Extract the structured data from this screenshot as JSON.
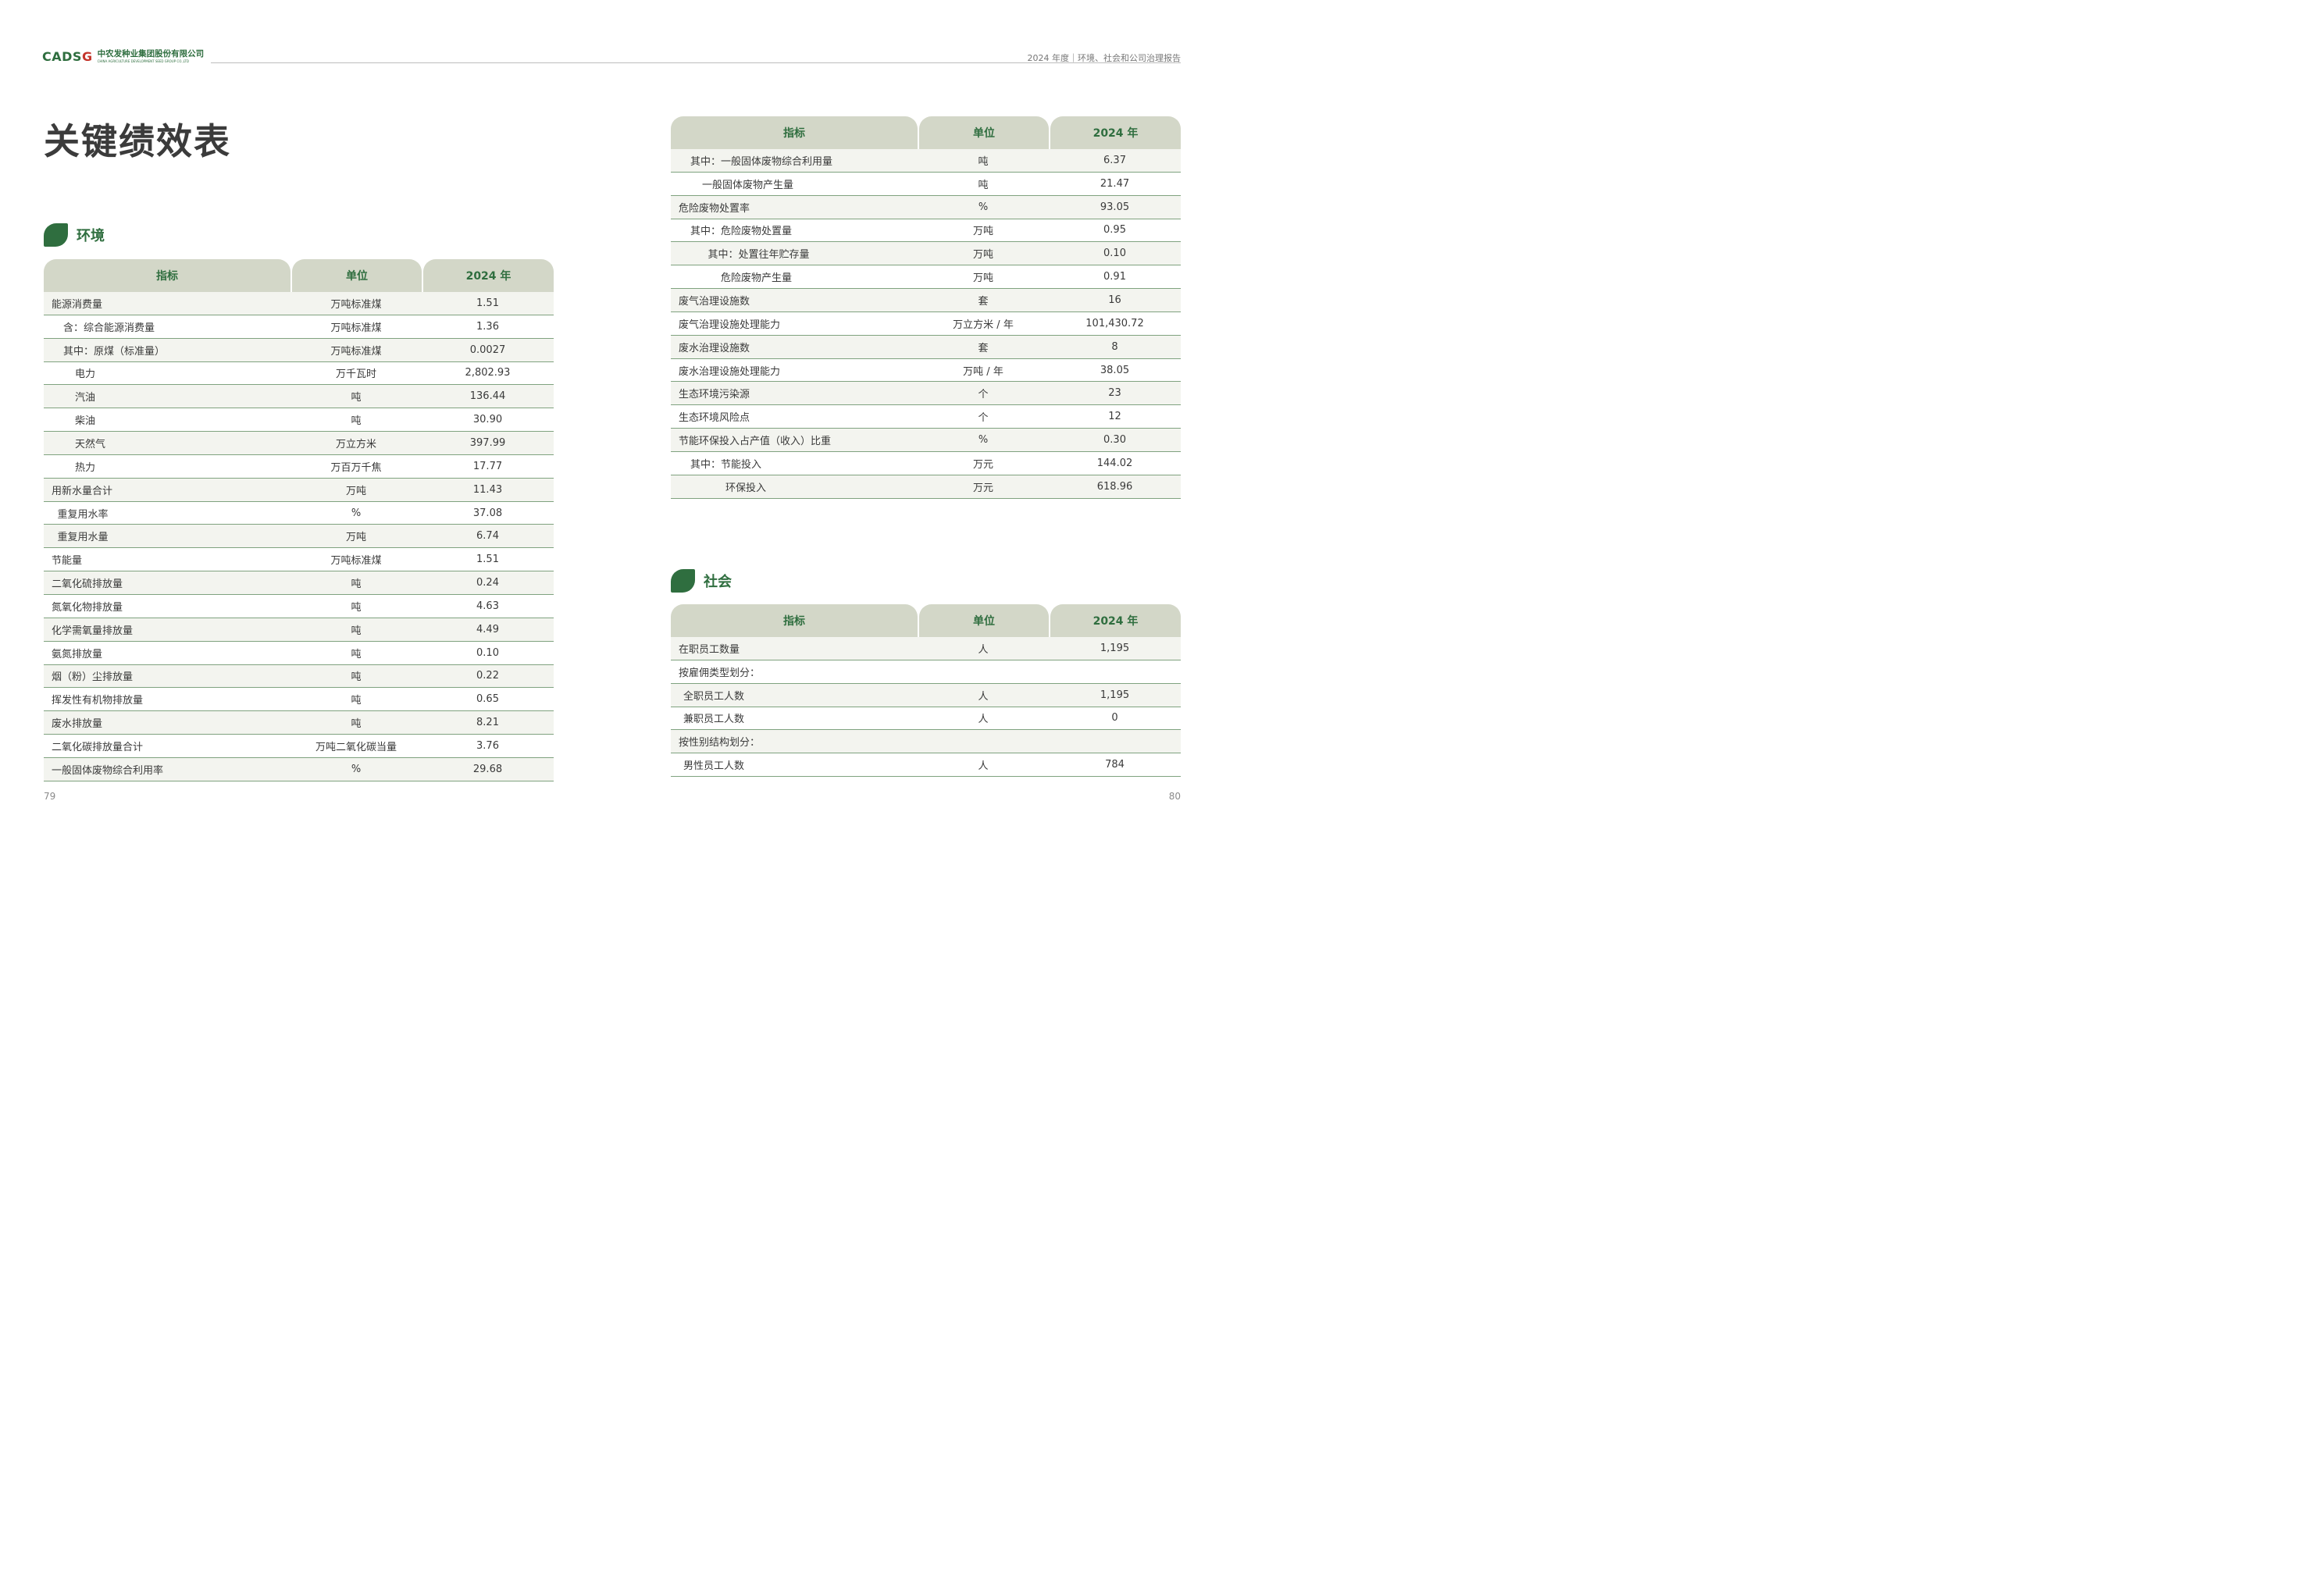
{
  "header": {
    "logo_mark_a": "CADS",
    "logo_mark_b": "G",
    "company_cn": "中农发种业集团股份有限公司",
    "company_en": "CHINA AGRICULTURE DEVELOPMENT SEED GROUP CO.,LTD",
    "report_title": "2024 年度｜环境、社会和公司治理报告"
  },
  "page_title": "关键绩效表",
  "colors": {
    "brand_green": "#2f6e3f",
    "header_fill": "#d3d7c8",
    "row_alt": "#f3f4ef"
  },
  "table_headers": {
    "indicator": "指标",
    "unit": "单位",
    "year": "2024 年"
  },
  "environment": {
    "title": "环境",
    "rows": [
      {
        "name": "能源消费量",
        "indent": 0,
        "unit": "万吨标准煤",
        "value": "1.51"
      },
      {
        "name": "含：综合能源消费量",
        "indent": 1,
        "unit": "万吨标准煤",
        "value": "1.36"
      },
      {
        "name": "其中：原煤（标准量）",
        "indent": 1,
        "unit": "万吨标准煤",
        "value": "0.0027"
      },
      {
        "name": "电力",
        "indent": 2,
        "unit": "万千瓦时",
        "value": "2,802.93"
      },
      {
        "name": "汽油",
        "indent": 2,
        "unit": "吨",
        "value": "136.44"
      },
      {
        "name": "柴油",
        "indent": 2,
        "unit": "吨",
        "value": "30.90"
      },
      {
        "name": "天然气",
        "indent": 2,
        "unit": "万立方米",
        "value": "397.99"
      },
      {
        "name": "热力",
        "indent": 2,
        "unit": "万百万千焦",
        "value": "17.77"
      },
      {
        "name": "用新水量合计",
        "indent": 0,
        "unit": "万吨",
        "value": "11.43"
      },
      {
        "name": "重复用水率",
        "indent": 0.5,
        "unit": "%",
        "value": "37.08"
      },
      {
        "name": "重复用水量",
        "indent": 0.5,
        "unit": "万吨",
        "value": "6.74"
      },
      {
        "name": "节能量",
        "indent": 0,
        "unit": "万吨标准煤",
        "value": "1.51"
      },
      {
        "name": "二氧化硫排放量",
        "indent": 0,
        "unit": "吨",
        "value": "0.24"
      },
      {
        "name": "氮氧化物排放量",
        "indent": 0,
        "unit": "吨",
        "value": "4.63"
      },
      {
        "name": "化学需氧量排放量",
        "indent": 0,
        "unit": "吨",
        "value": "4.49"
      },
      {
        "name": "氨氮排放量",
        "indent": 0,
        "unit": "吨",
        "value": "0.10"
      },
      {
        "name": "烟（粉）尘排放量",
        "indent": 0,
        "unit": "吨",
        "value": "0.22"
      },
      {
        "name": "挥发性有机物排放量",
        "indent": 0,
        "unit": "吨",
        "value": "0.65"
      },
      {
        "name": "废水排放量",
        "indent": 0,
        "unit": "吨",
        "value": "8.21"
      },
      {
        "name": "二氧化碳排放量合计",
        "indent": 0,
        "unit": "万吨二氧化碳当量",
        "value": "3.76"
      },
      {
        "name": "一般固体废物综合利用率",
        "indent": 0,
        "unit": "%",
        "value": "29.68"
      }
    ]
  },
  "environment_cont": {
    "rows": [
      {
        "name": "其中：一般固体废物综合利用量",
        "indent": 1,
        "unit": "吨",
        "value": "6.37"
      },
      {
        "name": "一般固体废物产生量",
        "indent": 2,
        "unit": "吨",
        "value": "21.47"
      },
      {
        "name": "危险废物处置率",
        "indent": 0,
        "unit": "%",
        "value": "93.05"
      },
      {
        "name": "其中：危险废物处置量",
        "indent": 1,
        "unit": "万吨",
        "value": "0.95"
      },
      {
        "name": "其中：处置往年贮存量",
        "indent": 2.5,
        "unit": "万吨",
        "value": "0.10"
      },
      {
        "name": "危险废物产生量",
        "indent": 3.6,
        "unit": "万吨",
        "value": "0.91"
      },
      {
        "name": "废气治理设施数",
        "indent": 0,
        "unit": "套",
        "value": "16"
      },
      {
        "name": "废气治理设施处理能力",
        "indent": 0,
        "unit": "万立方米 / 年",
        "value": "101,430.72"
      },
      {
        "name": "废水治理设施数",
        "indent": 0,
        "unit": "套",
        "value": "8"
      },
      {
        "name": "废水治理设施处理能力",
        "indent": 0,
        "unit": "万吨 / 年",
        "value": "38.05"
      },
      {
        "name": "生态环境污染源",
        "indent": 0,
        "unit": "个",
        "value": "23"
      },
      {
        "name": "生态环境风险点",
        "indent": 0,
        "unit": "个",
        "value": "12"
      },
      {
        "name": "节能环保投入占产值（收入）比重",
        "indent": 0,
        "unit": "%",
        "value": "0.30"
      },
      {
        "name": "其中：节能投入",
        "indent": 1,
        "unit": "万元",
        "value": "144.02"
      },
      {
        "name": "环保投入",
        "indent": 4,
        "unit": "万元",
        "value": "618.96"
      }
    ]
  },
  "society": {
    "title": "社会",
    "rows": [
      {
        "name": "在职员工数量",
        "indent": 0,
        "unit": "人",
        "value": "1,195"
      },
      {
        "name": "按雇佣类型划分：",
        "indent": 0,
        "unit": "",
        "value": ""
      },
      {
        "name": "全职员工人数",
        "indent": 0.4,
        "unit": "人",
        "value": "1,195"
      },
      {
        "name": "兼职员工人数",
        "indent": 0.4,
        "unit": "人",
        "value": "0"
      },
      {
        "name": "按性别结构划分：",
        "indent": 0,
        "unit": "",
        "value": ""
      },
      {
        "name": "男性员工人数",
        "indent": 0.4,
        "unit": "人",
        "value": "784"
      }
    ]
  },
  "page_numbers": {
    "left": "79",
    "right": "80"
  }
}
